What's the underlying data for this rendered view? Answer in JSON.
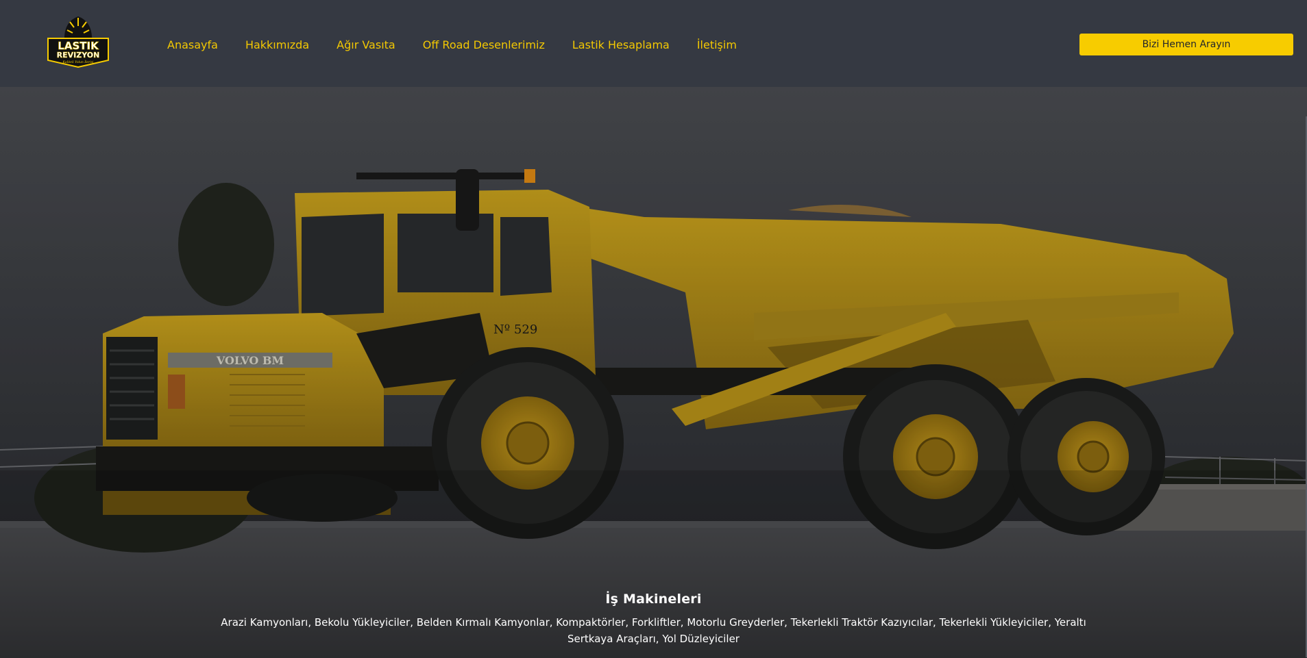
{
  "brand": {
    "logo_line1": "LASTIK",
    "logo_line2": "REVIZYON",
    "logo_tagline": "Kaliteli Yolun İlerisi"
  },
  "nav": {
    "items": [
      {
        "label": "Anasayfa"
      },
      {
        "label": "Hakkımızda"
      },
      {
        "label": "Ağır Vasıta"
      },
      {
        "label": "Off Road Desenlerimiz"
      },
      {
        "label": "Lastik Hesaplama"
      },
      {
        "label": "İletişim"
      }
    ],
    "cta_label": "Bizi Hemen Arayın"
  },
  "hero": {
    "title": "İş Makineleri",
    "description": "Arazi Kamyonları, Bekolu Yükleyiciler, Belden Kırmalı Kamyonlar, Kompaktörler, Forkliftler, Motorlu Greyderler, Tekerlekli Traktör Kazıyıcılar, Tekerlekli Yükleyiciler, Yeraltı Sertkaya Araçları, Yol Düzleyiciler",
    "truck_brand_plate": "VOLVO BM",
    "truck_number_plate": "Nº 529"
  },
  "colors": {
    "navbar_bg": "#353942",
    "accent": "#f7cc00",
    "nav_text": "#f3c802"
  }
}
